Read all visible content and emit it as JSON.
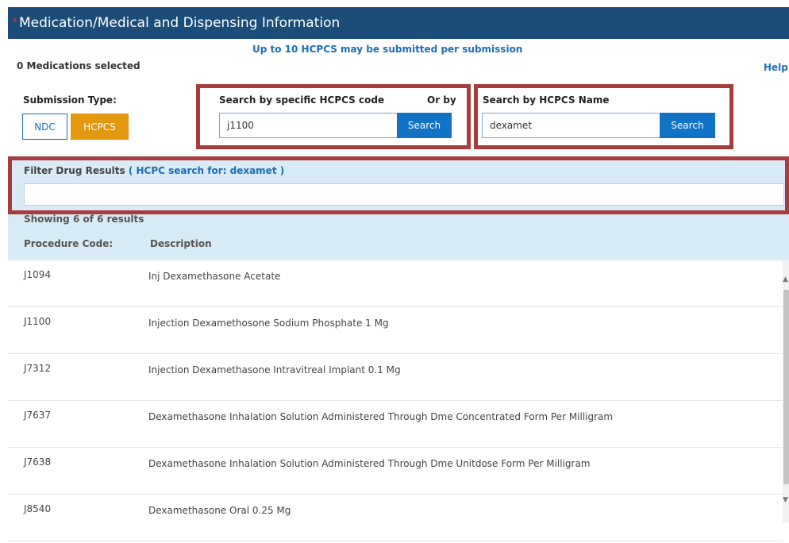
{
  "header": {
    "required_marker": "*",
    "title": "Medication/Medical and Dispensing Information"
  },
  "limit_note": "Up to 10 HCPCS may be submitted per submission",
  "medications_selected": "0 Medications selected",
  "help_link": "Help",
  "submission_type": {
    "label": "Submission Type:",
    "ndc_label": "NDC",
    "hcpcs_label": "HCPCS",
    "active": "HCPCS",
    "active_color": "#e4980f"
  },
  "code_search": {
    "label": "Search by specific HCPCS code",
    "or_by": "Or by",
    "value": "j1100",
    "button": "Search"
  },
  "name_search": {
    "label": "Search by HCPCS Name",
    "value": "dexamet",
    "button": "Search"
  },
  "filter": {
    "label": "Filter Drug Results",
    "query_text": "( HCPC search for: dexamet )",
    "value": ""
  },
  "results": {
    "showing": "Showing 6 of 6 results",
    "col_code": "Procedure Code:",
    "col_desc": "Description",
    "rows": [
      {
        "code": "J1094",
        "description": "Inj Dexamethasone Acetate"
      },
      {
        "code": "J1100",
        "description": "Injection Dexamethosone Sodium Phosphate 1 Mg"
      },
      {
        "code": "J7312",
        "description": "Injection Dexamethasone Intravitreal Implant 0.1 Mg"
      },
      {
        "code": "J7637",
        "description": "Dexamethasone Inhalation Solution Administered Through Dme Concentrated Form Per Milligram"
      },
      {
        "code": "J7638",
        "description": "Dexamethasone Inhalation Solution Administered Through Dme Unitdose Form Per Milligram"
      },
      {
        "code": "J8540",
        "description": "Dexamethasone Oral 0.25 Mg"
      }
    ]
  },
  "colors": {
    "header_bg": "#1c4d78",
    "search_button": "#1173c5",
    "highlight_box": "#a83c3c",
    "filter_panel": "#d9ebf5"
  },
  "icons": {
    "scroll_up": "chevron-up-icon",
    "scroll_down": "chevron-down-icon"
  }
}
